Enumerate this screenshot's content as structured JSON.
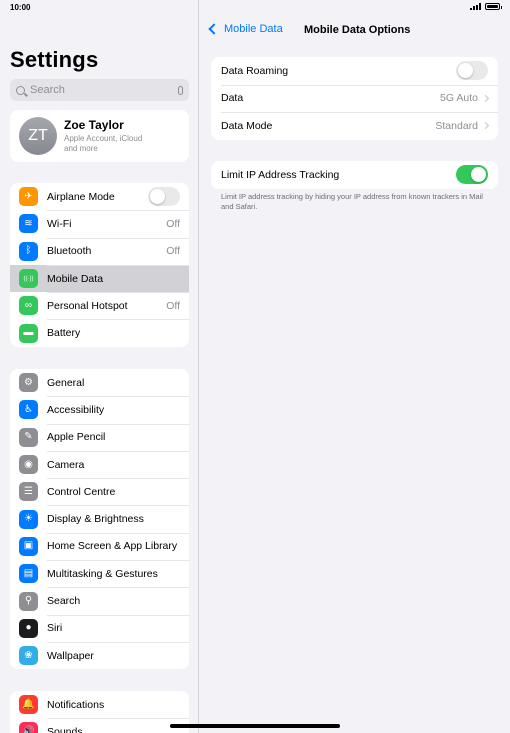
{
  "status_bar": {
    "time": "10:00"
  },
  "sidebar": {
    "title": "Settings",
    "search": {
      "placeholder": "Search"
    },
    "profile": {
      "initials": "ZT",
      "name": "Zoe Taylor",
      "subtitle_line1": "Apple Account, iCloud",
      "subtitle_line2": "and more"
    },
    "groups": [
      [
        {
          "id": "airplane",
          "label": "Airplane Mode",
          "icon": "airplane-icon",
          "color": "#ff9500",
          "glyph": "✈",
          "toggle": false
        },
        {
          "id": "wifi",
          "label": "Wi-Fi",
          "icon": "wifi-icon",
          "color": "#007aff",
          "glyph": "≋",
          "value": "Off"
        },
        {
          "id": "bluetooth",
          "label": "Bluetooth",
          "icon": "bluetooth-icon",
          "color": "#007aff",
          "glyph": "ᛒ",
          "value": "Off"
        },
        {
          "id": "mobile-data",
          "label": "Mobile Data",
          "icon": "antenna-icon",
          "color": "#34c759",
          "glyph": "((·))",
          "selected": true
        },
        {
          "id": "hotspot",
          "label": "Personal Hotspot",
          "icon": "hotspot-icon",
          "color": "#34c759",
          "glyph": "∞",
          "value": "Off"
        },
        {
          "id": "battery",
          "label": "Battery",
          "icon": "battery-icon",
          "color": "#34c759",
          "glyph": "▬"
        }
      ],
      [
        {
          "id": "general",
          "label": "General",
          "icon": "gear-icon",
          "color": "#8e8e93",
          "glyph": "⚙"
        },
        {
          "id": "accessibility",
          "label": "Accessibility",
          "icon": "accessibility-icon",
          "color": "#007aff",
          "glyph": "♿"
        },
        {
          "id": "pencil",
          "label": "Apple Pencil",
          "icon": "pencil-icon",
          "color": "#8e8e93",
          "glyph": "✎"
        },
        {
          "id": "camera",
          "label": "Camera",
          "icon": "camera-icon",
          "color": "#8e8e93",
          "glyph": "◉"
        },
        {
          "id": "control-centre",
          "label": "Control Centre",
          "icon": "switches-icon",
          "color": "#8e8e93",
          "glyph": "☰"
        },
        {
          "id": "display",
          "label": "Display & Brightness",
          "icon": "sun-icon",
          "color": "#007aff",
          "glyph": "☀"
        },
        {
          "id": "home-screen",
          "label": "Home Screen & App Library",
          "icon": "home-screen-icon",
          "color": "#007aff",
          "glyph": "▣"
        },
        {
          "id": "multitasking",
          "label": "Multitasking & Gestures",
          "icon": "multitasking-icon",
          "color": "#007aff",
          "glyph": "▤"
        },
        {
          "id": "search",
          "label": "Search",
          "icon": "search-icon",
          "color": "#8e8e93",
          "glyph": "⚲"
        },
        {
          "id": "siri",
          "label": "Siri",
          "icon": "siri-icon",
          "color": "#1c1c1e",
          "glyph": "●"
        },
        {
          "id": "wallpaper",
          "label": "Wallpaper",
          "icon": "wallpaper-icon",
          "color": "#32ade6",
          "glyph": "❀"
        }
      ],
      [
        {
          "id": "notifications",
          "label": "Notifications",
          "icon": "bell-icon",
          "color": "#ff3b30",
          "glyph": "🔔"
        },
        {
          "id": "sounds",
          "label": "Sounds",
          "icon": "speaker-icon",
          "color": "#ff2d55",
          "glyph": "🔊"
        }
      ]
    ]
  },
  "detail": {
    "back_label": "Mobile Data",
    "title": "Mobile Data Options",
    "group1": [
      {
        "id": "data-roaming",
        "label": "Data Roaming",
        "toggle": false
      },
      {
        "id": "data",
        "label": "Data",
        "value": "5G Auto"
      },
      {
        "id": "data-mode",
        "label": "Data Mode",
        "value": "Standard"
      }
    ],
    "group2": [
      {
        "id": "limit-ip",
        "label": "Limit IP Address Tracking",
        "toggle": true
      }
    ],
    "footnote": "Limit IP address tracking by hiding your IP address from known trackers in Mail and Safari."
  }
}
